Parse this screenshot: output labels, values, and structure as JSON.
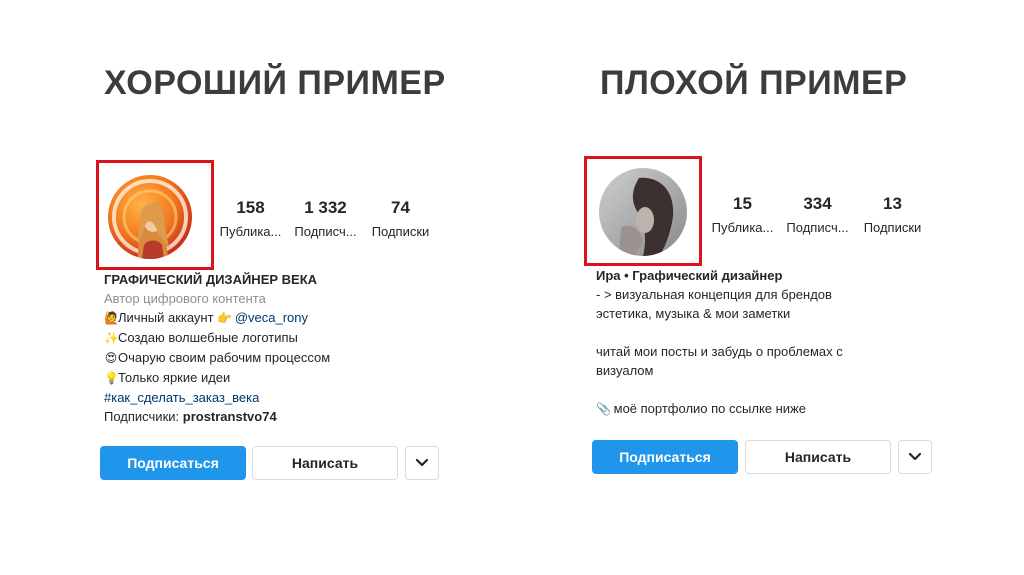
{
  "good": {
    "heading": "ХОРОШИЙ ПРИМЕР",
    "avatar_alt": "avatar",
    "stats": [
      {
        "num": "158",
        "label": "Публика..."
      },
      {
        "num": "1 332",
        "label": "Подписч..."
      },
      {
        "num": "74",
        "label": "Подписки"
      }
    ],
    "bio": {
      "name": "ГРАФИЧЕСКИЙ ДИЗАЙНЕР ВЕКА",
      "category": "Автор цифрового контента",
      "line1_text": "Личный аккаунт",
      "line1_mention": "@veca_rony",
      "line2": "Создаю волшебные логотипы",
      "line3": "Очарую своим рабочим процессом",
      "line4": "Только яркие идеи",
      "hashtag": "#как_сделать_заказ_века",
      "followers_prefix": "Подписчики:",
      "followers_name": "prostranstvo74"
    },
    "buttons": {
      "follow": "Подписаться",
      "message": "Написать",
      "more": "⌄"
    },
    "icons": {
      "line1": "raising-hand-emoji",
      "line1b": "pointing-hand-emoji",
      "line2": "sparkles-emoji",
      "line3": "heart-eyes-emoji",
      "line4": "light-bulb-emoji"
    }
  },
  "bad": {
    "heading": "ПЛОХОЙ ПРИМЕР",
    "stats": [
      {
        "num": "15",
        "label": "Публика..."
      },
      {
        "num": "334",
        "label": "Подписч..."
      },
      {
        "num": "13",
        "label": "Подписки"
      }
    ],
    "bio": {
      "name": "Ира • Графический дизайнер",
      "line1": "- > визуальная концепция для брендов",
      "line2": "эстетика, музыка & мои заметки",
      "line3": "читай мои посты и забудь о проблемах с",
      "line4": "визуалом",
      "line5": "моё портфолио по ссылке ниже"
    },
    "buttons": {
      "follow": "Подписаться",
      "message": "Написать",
      "more": "⌄"
    },
    "icons": {
      "line5": "paperclip-emoji"
    }
  },
  "colors": {
    "highlight": "#d9141b",
    "follow_button": "#1f96ec",
    "link": "#00376b",
    "muted": "#8e8e8e"
  }
}
